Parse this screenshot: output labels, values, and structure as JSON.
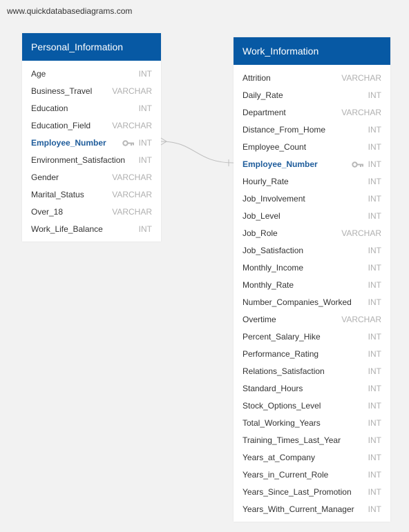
{
  "watermark": "www.quickdatabasediagrams.com",
  "colors": {
    "header_bg": "#0759a4",
    "pk_text": "#1e5c9b",
    "type_text": "#b0b0b0",
    "key_icon": "#b8b8b8",
    "connector": "#bdbdbd"
  },
  "tables": {
    "personal": {
      "name": "Personal_Information",
      "columns": [
        {
          "name": "Age",
          "type": "INT"
        },
        {
          "name": "Business_Travel",
          "type": "VARCHAR"
        },
        {
          "name": "Education",
          "type": "INT"
        },
        {
          "name": "Education_Field",
          "type": "VARCHAR"
        },
        {
          "name": "Employee_Number",
          "type": "INT",
          "pk": true,
          "icon": "key-icon"
        },
        {
          "name": "Environment_Satisfaction",
          "type": "INT"
        },
        {
          "name": "Gender",
          "type": "VARCHAR"
        },
        {
          "name": "Marital_Status",
          "type": "VARCHAR"
        },
        {
          "name": "Over_18",
          "type": "VARCHAR"
        },
        {
          "name": "Work_Life_Balance",
          "type": "INT"
        }
      ]
    },
    "work": {
      "name": "Work_Information",
      "columns": [
        {
          "name": "Attrition",
          "type": "VARCHAR"
        },
        {
          "name": "Daily_Rate",
          "type": "INT"
        },
        {
          "name": "Department",
          "type": "VARCHAR"
        },
        {
          "name": "Distance_From_Home",
          "type": "INT"
        },
        {
          "name": "Employee_Count",
          "type": "INT"
        },
        {
          "name": "Employee_Number",
          "type": "INT",
          "pk": true,
          "icon": "key-icon"
        },
        {
          "name": "Hourly_Rate",
          "type": "INT"
        },
        {
          "name": "Job_Involvement",
          "type": "INT"
        },
        {
          "name": "Job_Level",
          "type": "INT"
        },
        {
          "name": "Job_Role",
          "type": "VARCHAR"
        },
        {
          "name": "Job_Satisfaction",
          "type": "INT"
        },
        {
          "name": "Monthly_Income",
          "type": "INT"
        },
        {
          "name": "Monthly_Rate",
          "type": "INT"
        },
        {
          "name": "Number_Companies_Worked",
          "type": "INT"
        },
        {
          "name": "Overtime",
          "type": "VARCHAR"
        },
        {
          "name": "Percent_Salary_Hike",
          "type": "INT"
        },
        {
          "name": "Performance_Rating",
          "type": "INT"
        },
        {
          "name": "Relations_Satisfaction",
          "type": "INT"
        },
        {
          "name": "Standard_Hours",
          "type": "INT"
        },
        {
          "name": "Stock_Options_Level",
          "type": "INT"
        },
        {
          "name": "Total_Working_Years",
          "type": "INT"
        },
        {
          "name": "Training_Times_Last_Year",
          "type": "INT"
        },
        {
          "name": "Years_at_Company",
          "type": "INT"
        },
        {
          "name": "Years_in_Current_Role",
          "type": "INT"
        },
        {
          "name": "Years_Since_Last_Promotion",
          "type": "INT"
        },
        {
          "name": "Years_With_Current_Manager",
          "type": "INT"
        }
      ]
    }
  },
  "relationship": {
    "from": "Personal_Information.Employee_Number",
    "from_cardinality": "many",
    "to": "Work_Information.Employee_Number",
    "to_cardinality": "one"
  }
}
